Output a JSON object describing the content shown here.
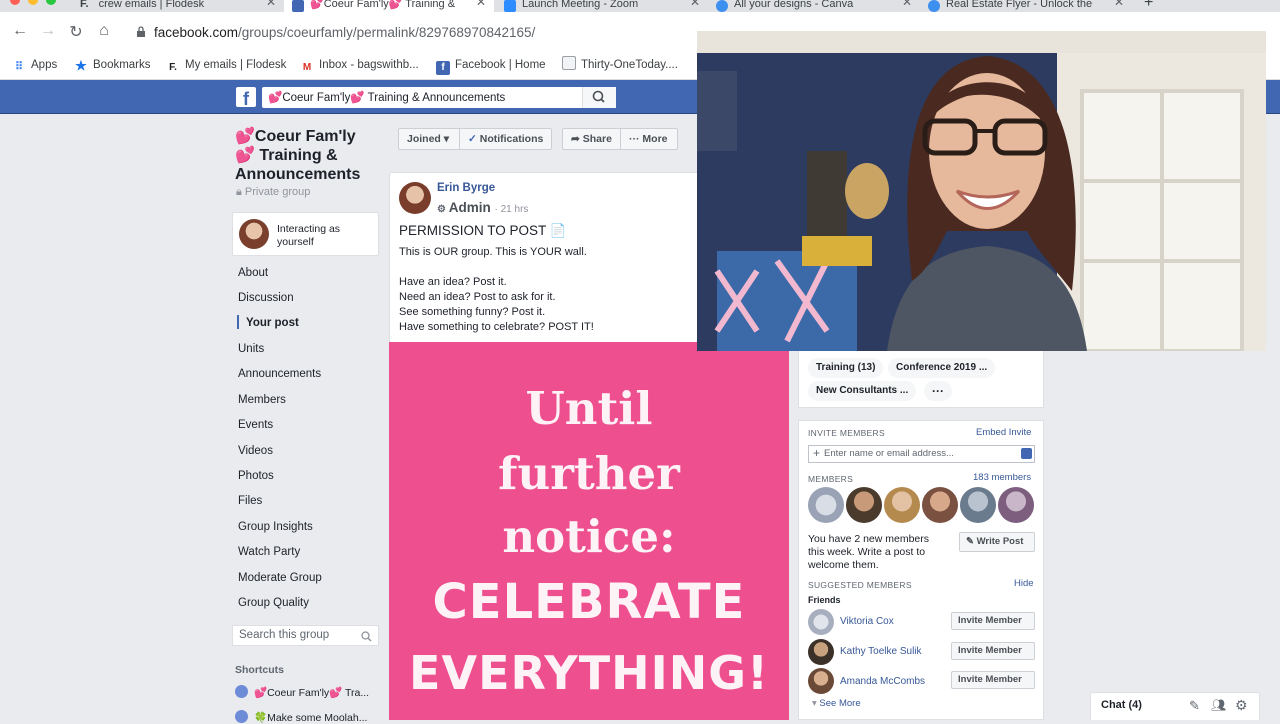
{
  "browser": {
    "tabs": [
      {
        "title": "crew emails | Flodesk",
        "favicon": "F."
      },
      {
        "title": "💕Coeur Fam'ly💕 Training &",
        "favicon": "f",
        "active": true
      },
      {
        "title": "Launch Meeting - Zoom",
        "favicon": "Z"
      },
      {
        "title": "All your designs - Canva",
        "favicon": "C"
      },
      {
        "title": "Real Estate Flyer - Unlock the",
        "favicon": "C"
      }
    ],
    "new_tab": "+",
    "url_host": "facebook.com",
    "url_path": "/groups/coeurfamly/permalink/829768970842165/",
    "bookmarks": [
      {
        "label": "Apps",
        "icon": "apps-grid"
      },
      {
        "label": "Bookmarks",
        "icon": "star"
      },
      {
        "label": "My emails | Flodesk",
        "icon": "F."
      },
      {
        "label": "Inbox - bagswithb...",
        "icon": "M"
      },
      {
        "label": "Facebook | Home",
        "icon": "f"
      },
      {
        "label": "Thirty-OneToday....",
        "icon": "doc"
      }
    ]
  },
  "fb": {
    "search_value": "💕Coeur Fam'ly💕 Training & Announcements",
    "brand_color": "#4267b2"
  },
  "group": {
    "name": "💕Coeur Fam'ly💕 Training & Announcements",
    "privacy": "Private group",
    "interacting": "Interacting as yourself",
    "nav": [
      "About",
      "Discussion",
      "Your post",
      "Units",
      "Announcements",
      "Members",
      "Events",
      "Videos",
      "Photos",
      "Files",
      "Group Insights",
      "Watch Party",
      "Moderate Group",
      "Group Quality"
    ],
    "active_nav": "Your post",
    "search_placeholder": "Search this group",
    "shortcuts_heading": "Shortcuts",
    "shortcuts": [
      "💕Coeur Fam'ly💕 Tra...",
      "🍀Make some Moolah..."
    ]
  },
  "actions": {
    "joined": "Joined",
    "notifications": "Notifications",
    "share": "Share",
    "more": "More"
  },
  "post": {
    "author": "Erin Byrge",
    "role": "Admin",
    "time": "· 21 hrs",
    "title": "PERMISSION TO POST 📄",
    "lines": [
      "This is OUR group.  This is YOUR wall.",
      "",
      "Have an idea? Post it.",
      "Need an idea? Post to ask for it.",
      "See something funny? Post it.",
      "Have something to celebrate? POST IT!"
    ],
    "image_lines_serif": [
      "Until",
      "further",
      "notice:"
    ],
    "image_lines_bold": [
      "CELEBRATE",
      "EVERYTHING!"
    ],
    "image_bg": "#ee4f8e"
  },
  "sidebar_right": {
    "tags": [
      "Training (13)",
      "Conference 2019 ...",
      "New Consultants ...",
      "···"
    ],
    "invite_heading": "INVITE MEMBERS",
    "embed_invite": "Embed Invite",
    "invite_placeholder": "Enter name or email address...",
    "members_heading": "MEMBERS",
    "members_count": "183 members",
    "new_members_text": "You have 2 new members this week. Write a post to welcome them.",
    "write_post": "Write Post",
    "suggested_heading": "SUGGESTED MEMBERS",
    "hide": "Hide",
    "friends_label": "Friends",
    "suggested": [
      {
        "name": "Viktoria Cox",
        "button": "Invite Member"
      },
      {
        "name": "Kathy Toelke Sulik",
        "button": "Invite Member"
      },
      {
        "name": "Amanda McCombs",
        "button": "Invite Member"
      }
    ],
    "see_more": "See More"
  },
  "chat": {
    "label": "Chat (4)"
  }
}
